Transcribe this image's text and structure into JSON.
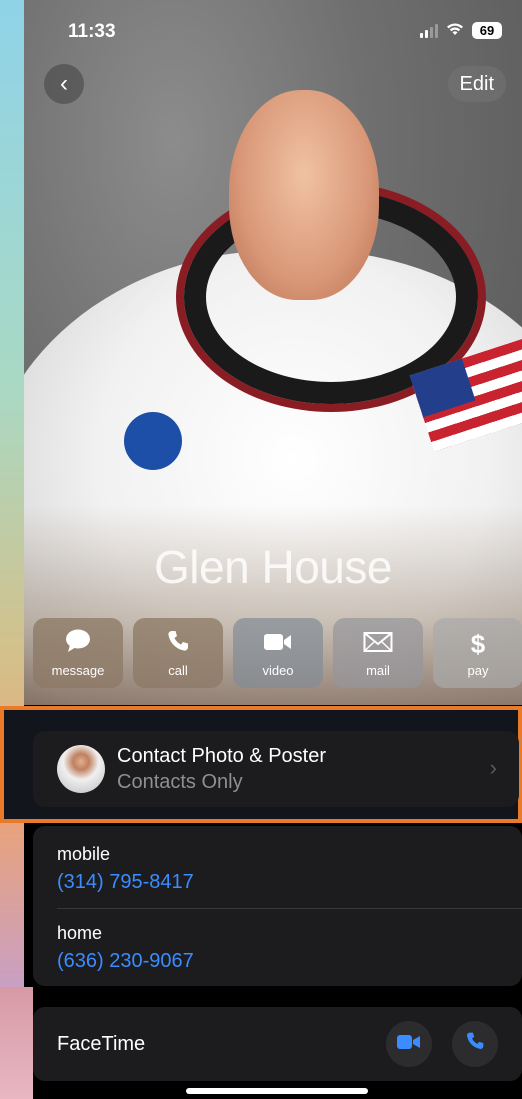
{
  "status_bar": {
    "time": "11:33",
    "battery": "69"
  },
  "nav": {
    "back_icon": "‹",
    "edit_label": "Edit"
  },
  "contact": {
    "name": "Glen House"
  },
  "actions": [
    {
      "label": "message",
      "icon": "message-icon"
    },
    {
      "label": "call",
      "icon": "phone-icon"
    },
    {
      "label": "video",
      "icon": "video-icon"
    },
    {
      "label": "mail",
      "icon": "mail-icon"
    },
    {
      "label": "pay",
      "icon": "dollar-icon"
    }
  ],
  "poster_row": {
    "title": "Contact Photo & Poster",
    "subtitle": "Contacts Only"
  },
  "phones": [
    {
      "label": "mobile",
      "number": "(314) 795-8417"
    },
    {
      "label": "home",
      "number": "(636) 230-9067"
    }
  ],
  "facetime": {
    "label": "FaceTime"
  },
  "colors": {
    "link": "#3a8cff",
    "highlight": "#e87a2a",
    "card": "#1c1c1e"
  }
}
